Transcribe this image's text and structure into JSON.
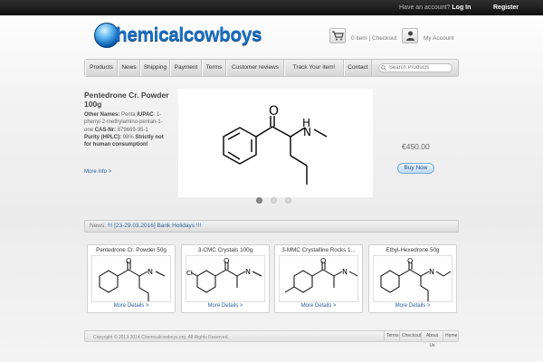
{
  "topbar": {
    "account_prompt": "Have an account?",
    "login_label": "Log In",
    "register_label": "Register"
  },
  "logo": {
    "text": "hemicalcowboys"
  },
  "header": {
    "cart_text": "0 item | Checkout",
    "account_text": "My Account"
  },
  "nav": {
    "items": [
      "Products",
      "News",
      "Shipping",
      "Payment",
      "Terms",
      "Customer reviews",
      "Track Your item!",
      "Contact"
    ],
    "search_placeholder": "Search Products"
  },
  "featured": {
    "title": "Pentedrone Cr. Powder 100g",
    "other_names_label": "Other Names:",
    "other_names_value": "Penta",
    "iupac_label": "IUPAC",
    "iupac_value": "1-phenyl-2-methylamino-pentan-1-one",
    "cas_label": "CAS-Nr:",
    "cas_value": "879669-95-1",
    "purity_label": "Purity (HPLC):",
    "purity_value": "98%",
    "warning": "Strictly not for human consumption!",
    "more_label": "More info >",
    "price": "€450.00",
    "buy_label": "Buy Now",
    "slide_count": 3,
    "active_slide": 1
  },
  "news": {
    "label": "News:",
    "headline": "!!! [23-29.03.2016] Bank Holidays !!!"
  },
  "products": [
    {
      "title": "Pentedrone Cr. Powder 50g",
      "more": "More Details >"
    },
    {
      "title": "3-CMC Crystals 100g",
      "more": "More Details >"
    },
    {
      "title": "3-MMC Crystalline Rocks 1...",
      "more": "More Details >"
    },
    {
      "title": "Ethyl-Hexedrone 50g",
      "more": "More Details >"
    }
  ],
  "footer": {
    "copyright": "Copyright © 2013-2014 Chemicalcowboys.org. All Rights Reserved.",
    "links": [
      "Terms",
      "Checkout",
      "About Us",
      "Home"
    ]
  },
  "colors": {
    "link": "#2a5f9e",
    "logo_blue": "#1b6fc0",
    "topbar": "#1a1a1a"
  }
}
